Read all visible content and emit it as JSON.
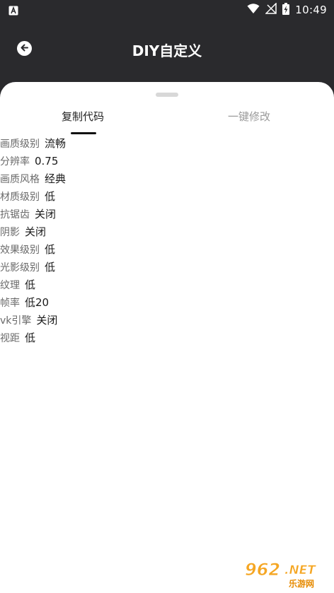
{
  "status_bar": {
    "time": "10:49",
    "icons": [
      "notification-a-icon",
      "wifi-icon",
      "signal-icon",
      "battery-charging-icon"
    ]
  },
  "header": {
    "title": "DIY自定义",
    "back_icon": "arrow-left-icon"
  },
  "tabs": [
    {
      "label": "复制代码",
      "active": true
    },
    {
      "label": "一键修改",
      "active": false
    }
  ],
  "settings": [
    {
      "label": "画质级别",
      "value": "流畅"
    },
    {
      "label": "分辨率",
      "value": "0.75"
    },
    {
      "label": "画质风格",
      "value": "经典"
    },
    {
      "label": "材质级别",
      "value": "低"
    },
    {
      "label": "抗锯齿",
      "value": "关闭"
    },
    {
      "label": "阴影",
      "value": "关闭"
    },
    {
      "label": "效果级别",
      "value": "低"
    },
    {
      "label": "光影级别",
      "value": "低"
    },
    {
      "label": "纹理",
      "value": "低"
    },
    {
      "label": "帧率",
      "value": "低20"
    },
    {
      "label": "vk引擎",
      "value": "关闭"
    },
    {
      "label": "视距",
      "value": "低"
    }
  ],
  "watermark": {
    "brand_text": "962.NET",
    "sub_text": "乐游网"
  },
  "colors": {
    "header_bg": "#2a2a2d",
    "sheet_bg": "#ffffff",
    "active_tab": "#222222",
    "inactive_tab": "#9a9a9a",
    "label": "#6a6a6a",
    "value": "#1a1a1a",
    "watermark_orange": "#f5a623"
  }
}
